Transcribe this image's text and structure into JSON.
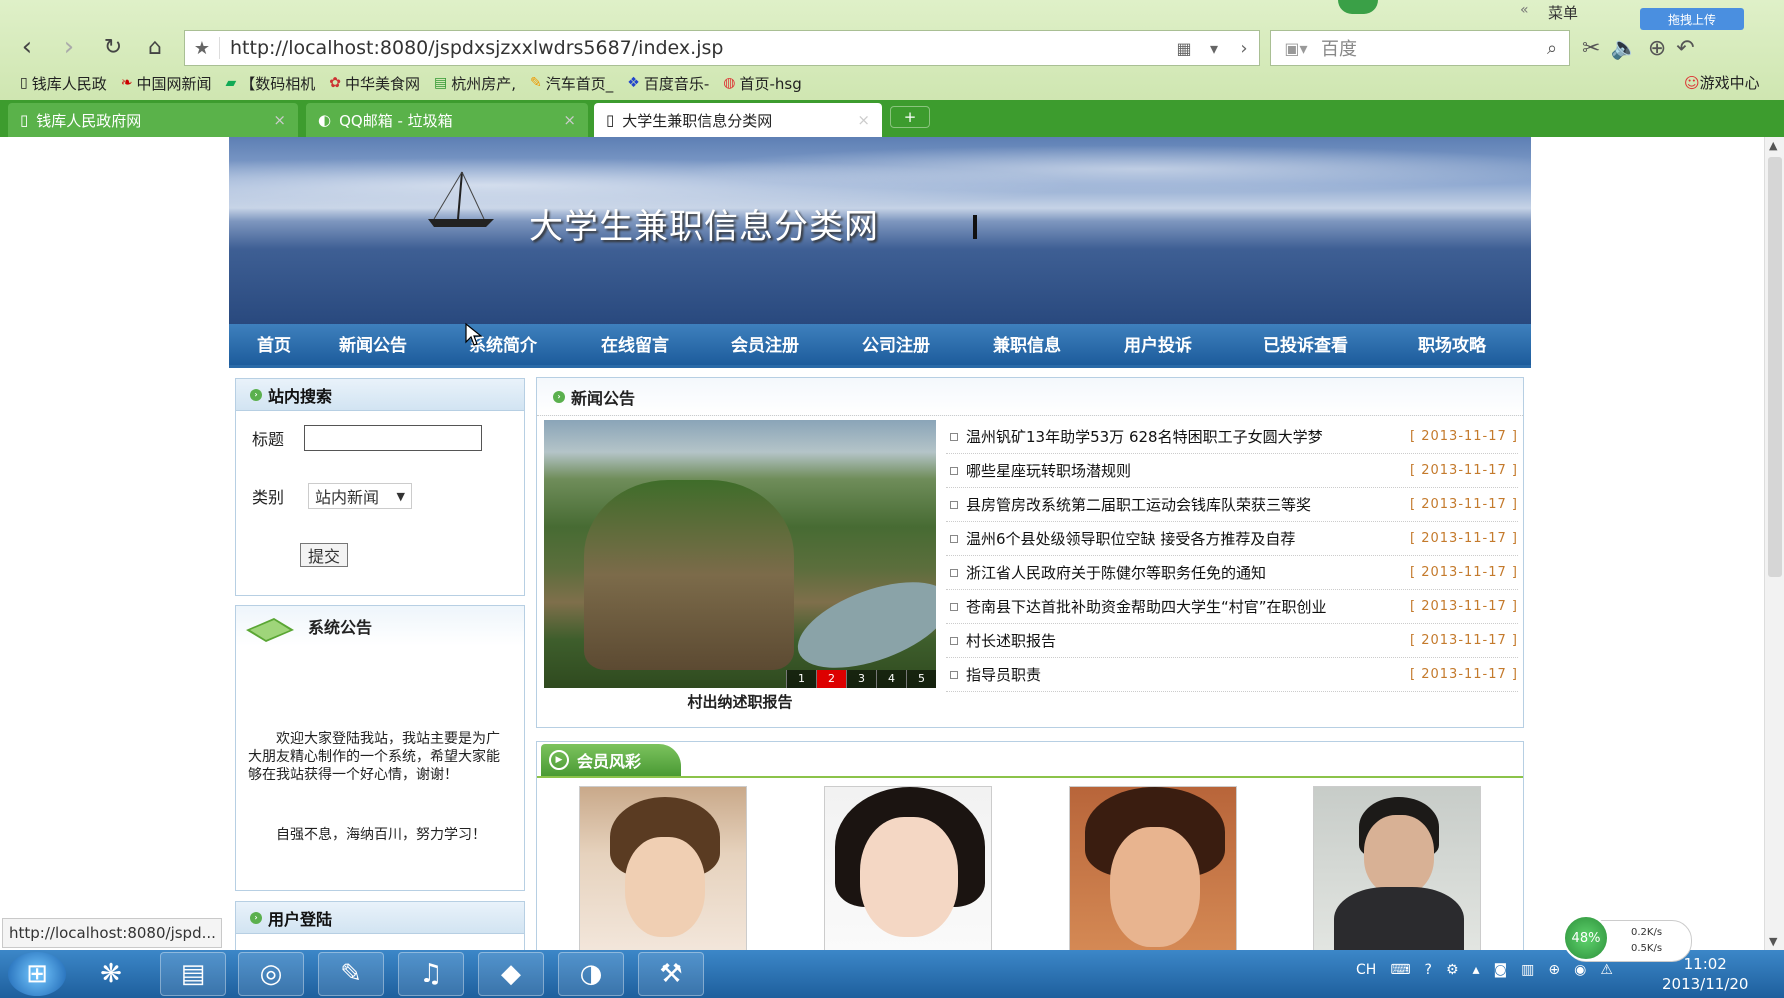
{
  "browser": {
    "url": "http://localhost:8080/jspdxsjzxxlwdrs5687/index.jsp",
    "search_placeholder": "百度",
    "menu_label": "菜单",
    "cloud_label": "拖拽上传",
    "game_center": "游戏中心",
    "bookmarks": [
      "钱库人民政",
      "中国网新闻",
      "【数码相机",
      "中华美食网",
      "杭州房产,",
      "汽车首页_",
      "百度音乐-",
      "首页-hsg"
    ],
    "tabs": [
      {
        "label": "钱库人民政府网",
        "active": false
      },
      {
        "label": "QQ邮箱 - 垃圾箱",
        "active": false
      },
      {
        "label": "大学生兼职信息分类网",
        "active": true
      }
    ],
    "status_url": "http://localhost:8080/jspd..."
  },
  "site": {
    "title": "大学生兼职信息分类网",
    "nav": [
      "首页",
      "新闻公告",
      "系统简介",
      "在线留言",
      "会员注册",
      "公司注册",
      "兼职信息",
      "用户投诉",
      "已投诉查看",
      "职场攻略"
    ],
    "search_box": {
      "heading": "站内搜索",
      "title_label": "标题",
      "type_label": "类别",
      "type_value": "站内新闻",
      "submit": "提交"
    },
    "notice_box": {
      "heading": "系统公告",
      "paragraph1": "欢迎大家登陆我站，我站主要是为广大朋友精心制作的一个系统，希望大家能够在我站获得一个好心情，谢谢！",
      "paragraph2": "自强不息，海纳百川，努力学习！"
    },
    "login_box": {
      "heading": "用户登陆"
    },
    "news": {
      "heading": "新闻公告",
      "slide_caption": "村出纳述职报告",
      "slide_pages": [
        "1",
        "2",
        "3",
        "4",
        "5"
      ],
      "active_page": "2",
      "items": [
        {
          "title": "温州钒矿13年助学53万 628名特困职工子女圆大学梦",
          "date": "[ 2013-11-17 ]"
        },
        {
          "title": "哪些星座玩转职场潜规则",
          "date": "[ 2013-11-17 ]"
        },
        {
          "title": "县房管房改系统第二届职工运动会钱库队荣获三等奖",
          "date": "[ 2013-11-17 ]"
        },
        {
          "title": "温州6个县处级领导职位空缺  接受各方推荐及自荐",
          "date": "[ 2013-11-17 ]"
        },
        {
          "title": "浙江省人民政府关于陈健尔等职务任免的通知",
          "date": "[ 2013-11-17 ]"
        },
        {
          "title": "苍南县下达首批补助资金帮助四大学生“村官”在职创业",
          "date": "[ 2013-11-17 ]"
        },
        {
          "title": "村长述职报告",
          "date": "[ 2013-11-17 ]"
        },
        {
          "title": "指导员职责",
          "date": "[ 2013-11-17 ]"
        }
      ]
    },
    "members": {
      "heading": "会员风彩"
    }
  },
  "taskbar": {
    "ime": "CH",
    "network_percent": "48%",
    "up_speed": "0.2K/s",
    "down_speed": "0.5K/s",
    "time": "11:02",
    "date": "2013/11/20"
  },
  "colors": {
    "nav_blue": "#2a6aa8",
    "tab_green": "#3d9c2e",
    "date_orange": "#c47a2c"
  }
}
